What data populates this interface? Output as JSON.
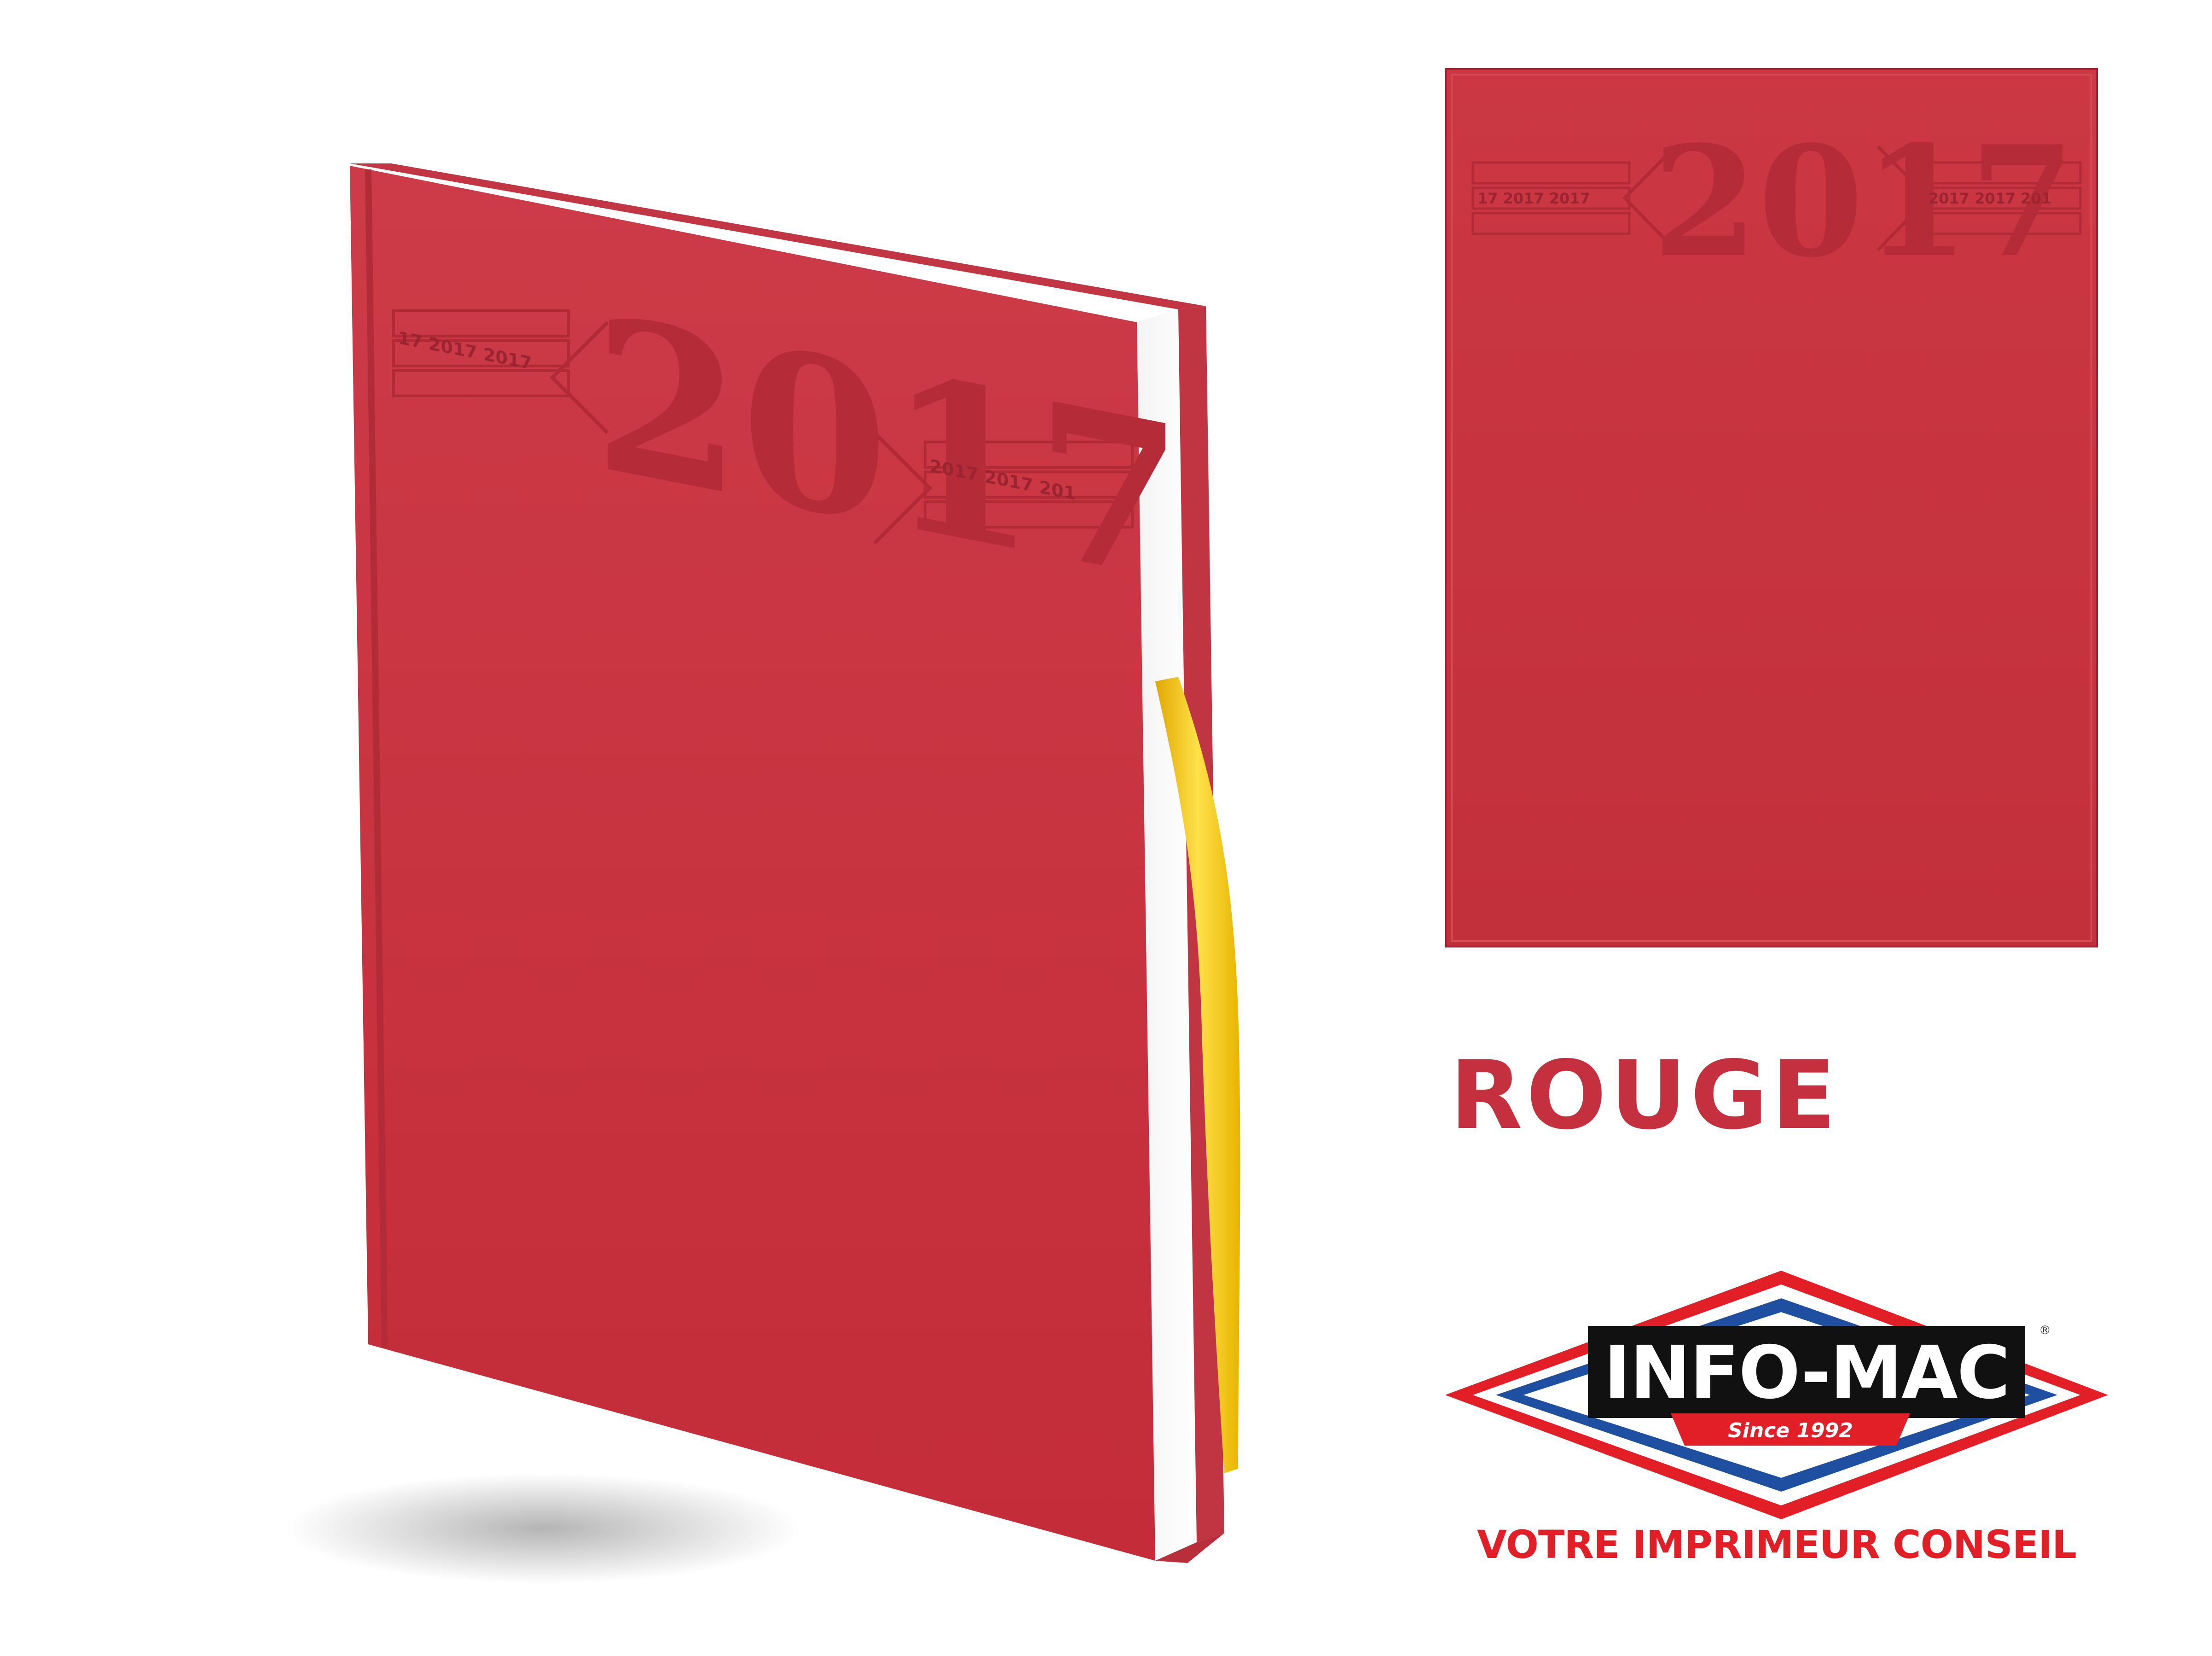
{
  "product": {
    "emboss_year": "2017",
    "emboss_band_left_text": "17 2017 2017",
    "emboss_band_right_text": "2017 2017 201",
    "flat_band_left_text": "17 2017 2017",
    "flat_band_right_text": "2017 2017 201",
    "cover_color": "#c9363f",
    "ribbon_color": "#f2c400"
  },
  "color_label": "ROUGE",
  "logo": {
    "brand": "INFO-MAC",
    "since": "Since 1992",
    "registered": "®",
    "tagline": "VOTRE IMPRIMEUR CONSEIL",
    "colors": {
      "red": "#e21f26",
      "blue": "#1f4fa0",
      "black": "#111111"
    }
  }
}
